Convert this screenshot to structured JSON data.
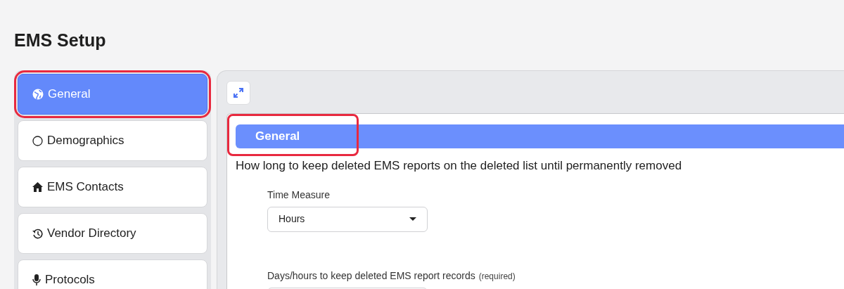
{
  "page": {
    "title": "EMS Setup"
  },
  "sidebar": {
    "items": [
      {
        "label": "General",
        "kind": "globe",
        "selected": true,
        "highlighted": true
      },
      {
        "label": "Demographics",
        "kind": "circle",
        "selected": false,
        "highlighted": false
      },
      {
        "label": "EMS Contacts",
        "kind": "home",
        "selected": false,
        "highlighted": false
      },
      {
        "label": "Vendor Directory",
        "kind": "history",
        "selected": false,
        "highlighted": false
      },
      {
        "label": "Protocols",
        "kind": "mic",
        "selected": false,
        "highlighted": false
      }
    ]
  },
  "section": {
    "title": "General",
    "highlighted": true,
    "description": "How long to keep deleted EMS reports on the deleted list until permanently removed",
    "fields": [
      {
        "kind": "select",
        "label": "Time Measure",
        "value": "Hours"
      },
      {
        "kind": "input",
        "label": "Days/hours to keep deleted EMS report records",
        "note": "(required)"
      }
    ]
  }
}
